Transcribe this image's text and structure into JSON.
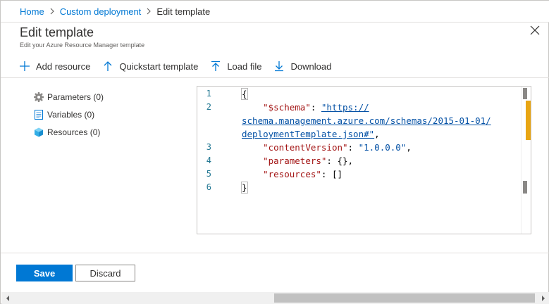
{
  "breadcrumb": {
    "home": "Home",
    "custom_deployment": "Custom deployment",
    "current": "Edit template"
  },
  "header": {
    "title": "Edit template",
    "subtitle": "Edit your Azure Resource Manager template"
  },
  "toolbar": {
    "add_resource": "Add resource",
    "quickstart_template": "Quickstart template",
    "load_file": "Load file",
    "download": "Download"
  },
  "tree": {
    "parameters": "Parameters (0)",
    "variables": "Variables (0)",
    "resources": "Resources (0)"
  },
  "editor": {
    "line_numbers": [
      "1",
      "2",
      "3",
      "4",
      "5",
      "6"
    ],
    "open_brace": "{",
    "schema_key": "\"$schema\"",
    "schema_url_1": "\"https://",
    "schema_url_2": "schema.management.azure.com/schemas/2015-01-01/",
    "schema_url_3": "deploymentTemplate.json#\"",
    "content_version_key": "\"contentVersion\"",
    "content_version_value": "\"1.0.0.0\"",
    "parameters_key": "\"parameters\"",
    "parameters_value": "{}",
    "resources_key": "\"resources\"",
    "resources_value": "[]",
    "close_brace": "}",
    "colon": ": ",
    "comma": ","
  },
  "footer": {
    "save": "Save",
    "discard": "Discard"
  },
  "colors": {
    "accent": "#0078d4",
    "warning_marker": "#e8a512"
  }
}
